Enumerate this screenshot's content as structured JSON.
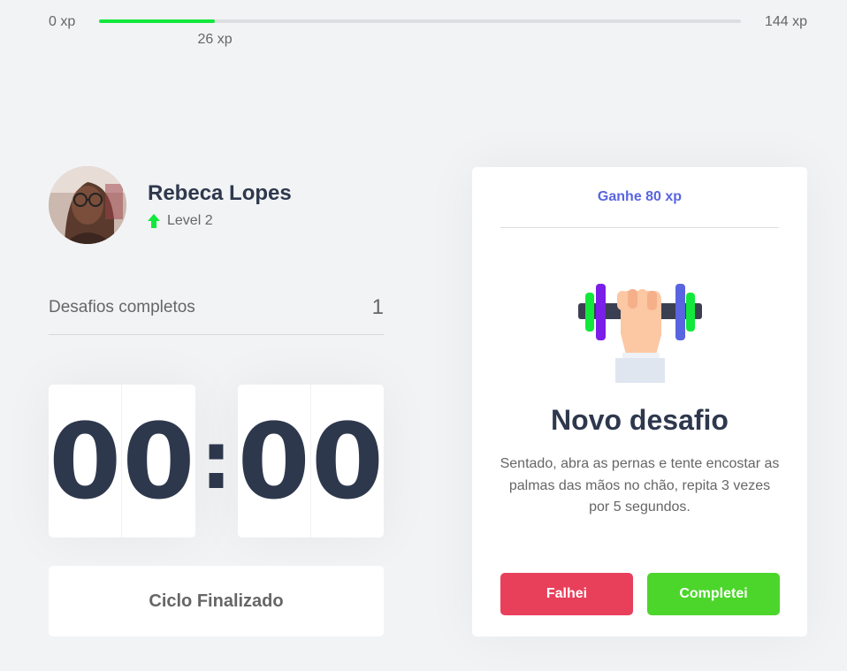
{
  "xp": {
    "min_label": "0 xp",
    "max_label": "144 xp",
    "current_label": "26 xp",
    "current": 26,
    "max": 144,
    "fill_color": "#12e83b"
  },
  "profile": {
    "name": "Rebeca Lopes",
    "level_label": "Level 2",
    "level_icon": "level-up-arrow-icon"
  },
  "stats": {
    "completed_label": "Desafios completos",
    "completed_count": "1"
  },
  "countdown": {
    "minute_left": "0",
    "minute_right": "0",
    "separator": ":",
    "second_left": "0",
    "second_right": "0"
  },
  "cycle_button": {
    "label": "Ciclo Finalizado"
  },
  "challenge": {
    "header": "Ganhe 80 xp",
    "icon": "dumbbell-hand-icon",
    "title": "Novo desafio",
    "description": "Sentado, abra as pernas e tente encostar as palmas das mãos no chão, repita 3 vezes por 5 segundos.",
    "fail_label": "Falhei",
    "success_label": "Completei"
  },
  "colors": {
    "background": "#f2f3f5",
    "title": "#2e384d",
    "text": "#666666",
    "accent": "#5965e0",
    "danger": "#e83f5b",
    "success": "#12e83b"
  }
}
